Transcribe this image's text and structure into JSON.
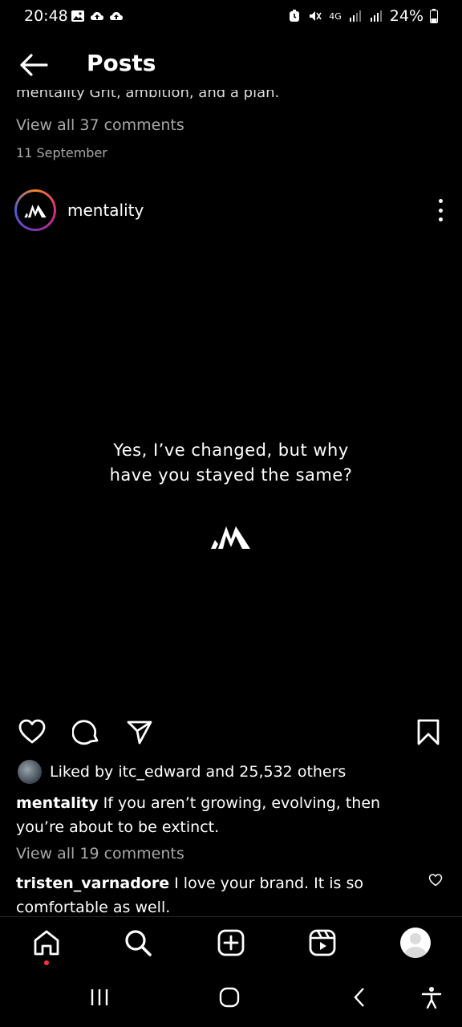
{
  "status_bar": {
    "time": "20:48",
    "network": "4G",
    "battery": "24%",
    "left_icons": [
      "image-icon",
      "cloud-upload-icon",
      "cloud-upload-icon"
    ],
    "right_icons": [
      "alarm-icon",
      "mute-icon",
      "signal-icon",
      "signal-icon",
      "battery-icon"
    ]
  },
  "header": {
    "title": "Posts",
    "back_icon": "arrow-left-icon"
  },
  "previous_post": {
    "caption_cut": "mentality Grit, ambition, and a plan.",
    "view_comments": "View all 37 comments",
    "date": "11 September"
  },
  "post": {
    "username": "mentality",
    "quote_line1": "Yes, I’ve changed, but why",
    "quote_line2": "have you stayed the same?",
    "likes_text": "Liked by itc_edward and 25,532 others",
    "caption_user": "mentality",
    "caption_text": "If you aren’t growing, evolving, then you’re about to be extinct.",
    "view_comments": "View all 19 comments",
    "comment_user": "tristen_varnadore",
    "comment_text": "I love your brand. It is so comfortable as well."
  },
  "bottom_nav": {
    "items": [
      "home-icon",
      "search-icon",
      "create-icon",
      "reels-icon",
      "profile-avatar"
    ]
  },
  "colors": {
    "background": "#000000",
    "text": "#ffffff",
    "muted": "#a8a8a8",
    "notification_dot": "#ff3040"
  }
}
